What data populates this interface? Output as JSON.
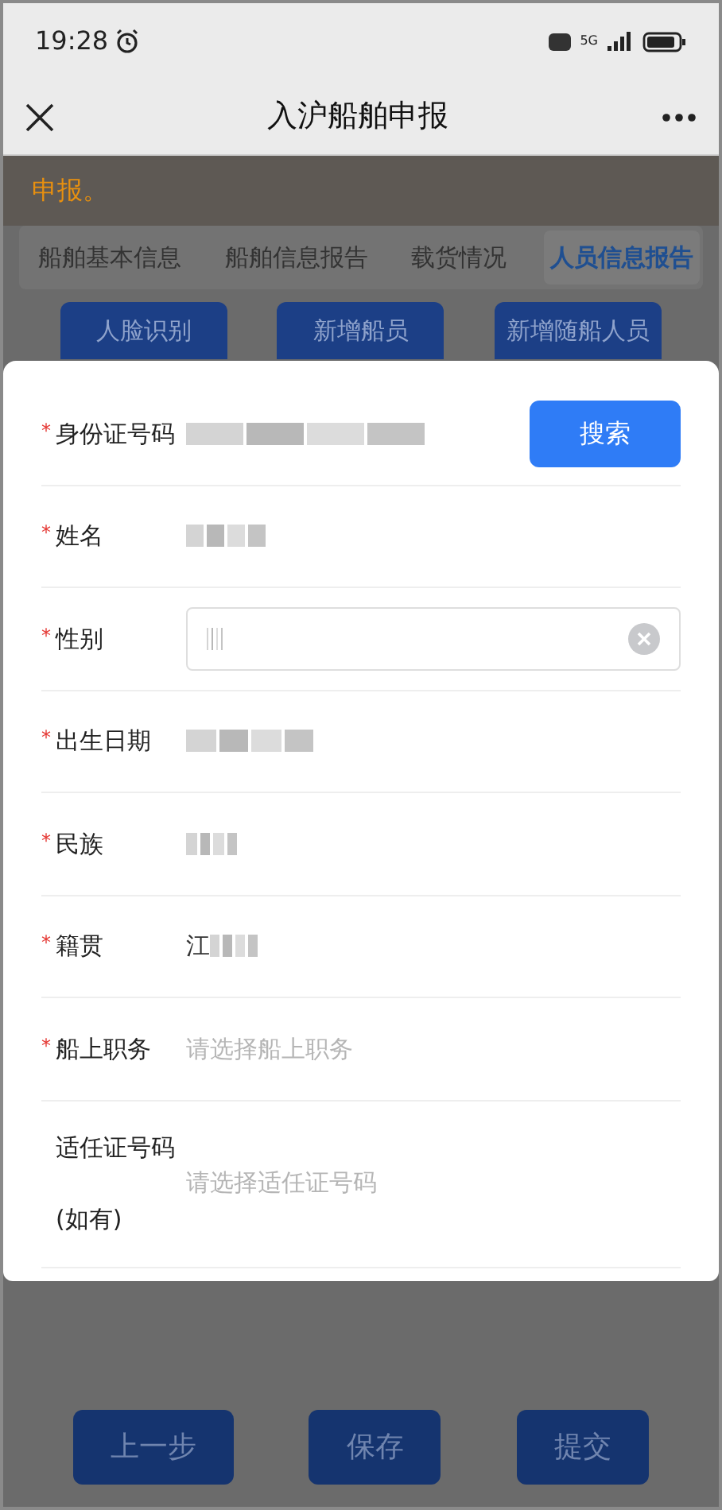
{
  "status_bar": {
    "time": "19:28",
    "network": "5G"
  },
  "nav": {
    "title": "入沪船舶申报"
  },
  "notice": "申报。",
  "tabs": [
    {
      "label": "船舶基本信息",
      "selected": false
    },
    {
      "label": "船舶信息报告",
      "selected": false
    },
    {
      "label": "载货情况",
      "selected": false
    },
    {
      "label": "人员信息报告",
      "selected": true
    }
  ],
  "actions": [
    "人脸识别",
    "新增船员",
    "新增随船人员"
  ],
  "form": {
    "rows": [
      {
        "kind": "search",
        "label": "身份证号码",
        "mark": "*",
        "redacted": true,
        "button": "搜索"
      },
      {
        "kind": "text",
        "label": "姓名",
        "mark": "*",
        "redacted": true
      },
      {
        "kind": "input",
        "label": "性别",
        "mark": "*",
        "redacted": true
      },
      {
        "kind": "text",
        "label": "出生日期",
        "mark": "*",
        "redacted": true
      },
      {
        "kind": "text",
        "label": "民族",
        "mark": "*",
        "redacted": true
      },
      {
        "kind": "text",
        "label": "籍贯",
        "mark": "*",
        "value": "江",
        "redacted": true
      },
      {
        "kind": "select",
        "label": "船上职务",
        "mark": "*",
        "placeholder": "请选择船上职务"
      },
      {
        "kind": "select",
        "label": "适任证号码",
        "label_note": "(如有)",
        "placeholder": "请选择适任证号码"
      }
    ]
  },
  "footer_buttons": [
    "上一步",
    "保存",
    "提交"
  ]
}
